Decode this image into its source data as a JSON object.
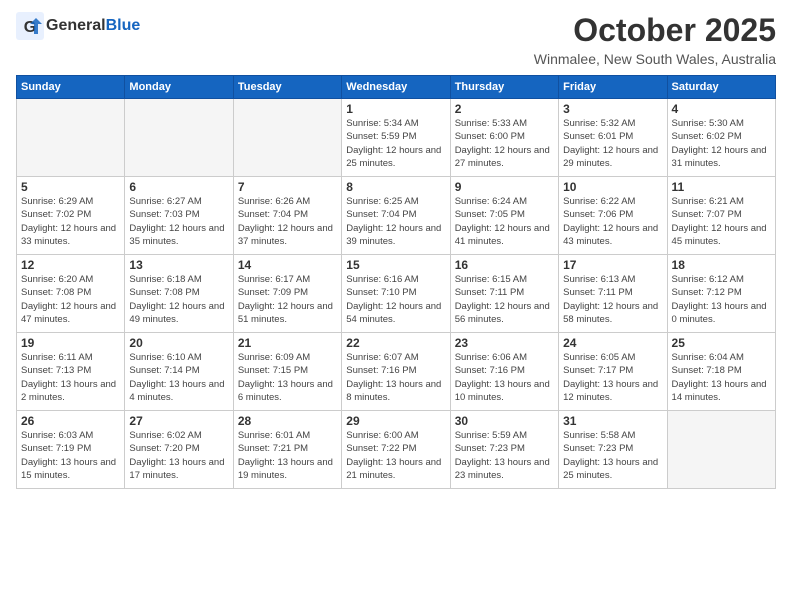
{
  "header": {
    "logo_general": "General",
    "logo_blue": "Blue",
    "month": "October 2025",
    "location": "Winmalee, New South Wales, Australia"
  },
  "days_of_week": [
    "Sunday",
    "Monday",
    "Tuesday",
    "Wednesday",
    "Thursday",
    "Friday",
    "Saturday"
  ],
  "weeks": [
    [
      {
        "date": "",
        "info": ""
      },
      {
        "date": "",
        "info": ""
      },
      {
        "date": "",
        "info": ""
      },
      {
        "date": "1",
        "info": "Sunrise: 5:34 AM\nSunset: 5:59 PM\nDaylight: 12 hours\nand 25 minutes."
      },
      {
        "date": "2",
        "info": "Sunrise: 5:33 AM\nSunset: 6:00 PM\nDaylight: 12 hours\nand 27 minutes."
      },
      {
        "date": "3",
        "info": "Sunrise: 5:32 AM\nSunset: 6:01 PM\nDaylight: 12 hours\nand 29 minutes."
      },
      {
        "date": "4",
        "info": "Sunrise: 5:30 AM\nSunset: 6:02 PM\nDaylight: 12 hours\nand 31 minutes."
      }
    ],
    [
      {
        "date": "5",
        "info": "Sunrise: 6:29 AM\nSunset: 7:02 PM\nDaylight: 12 hours\nand 33 minutes."
      },
      {
        "date": "6",
        "info": "Sunrise: 6:27 AM\nSunset: 7:03 PM\nDaylight: 12 hours\nand 35 minutes."
      },
      {
        "date": "7",
        "info": "Sunrise: 6:26 AM\nSunset: 7:04 PM\nDaylight: 12 hours\nand 37 minutes."
      },
      {
        "date": "8",
        "info": "Sunrise: 6:25 AM\nSunset: 7:04 PM\nDaylight: 12 hours\nand 39 minutes."
      },
      {
        "date": "9",
        "info": "Sunrise: 6:24 AM\nSunset: 7:05 PM\nDaylight: 12 hours\nand 41 minutes."
      },
      {
        "date": "10",
        "info": "Sunrise: 6:22 AM\nSunset: 7:06 PM\nDaylight: 12 hours\nand 43 minutes."
      },
      {
        "date": "11",
        "info": "Sunrise: 6:21 AM\nSunset: 7:07 PM\nDaylight: 12 hours\nand 45 minutes."
      }
    ],
    [
      {
        "date": "12",
        "info": "Sunrise: 6:20 AM\nSunset: 7:08 PM\nDaylight: 12 hours\nand 47 minutes."
      },
      {
        "date": "13",
        "info": "Sunrise: 6:18 AM\nSunset: 7:08 PM\nDaylight: 12 hours\nand 49 minutes."
      },
      {
        "date": "14",
        "info": "Sunrise: 6:17 AM\nSunset: 7:09 PM\nDaylight: 12 hours\nand 51 minutes."
      },
      {
        "date": "15",
        "info": "Sunrise: 6:16 AM\nSunset: 7:10 PM\nDaylight: 12 hours\nand 54 minutes."
      },
      {
        "date": "16",
        "info": "Sunrise: 6:15 AM\nSunset: 7:11 PM\nDaylight: 12 hours\nand 56 minutes."
      },
      {
        "date": "17",
        "info": "Sunrise: 6:13 AM\nSunset: 7:11 PM\nDaylight: 12 hours\nand 58 minutes."
      },
      {
        "date": "18",
        "info": "Sunrise: 6:12 AM\nSunset: 7:12 PM\nDaylight: 13 hours\nand 0 minutes."
      }
    ],
    [
      {
        "date": "19",
        "info": "Sunrise: 6:11 AM\nSunset: 7:13 PM\nDaylight: 13 hours\nand 2 minutes."
      },
      {
        "date": "20",
        "info": "Sunrise: 6:10 AM\nSunset: 7:14 PM\nDaylight: 13 hours\nand 4 minutes."
      },
      {
        "date": "21",
        "info": "Sunrise: 6:09 AM\nSunset: 7:15 PM\nDaylight: 13 hours\nand 6 minutes."
      },
      {
        "date": "22",
        "info": "Sunrise: 6:07 AM\nSunset: 7:16 PM\nDaylight: 13 hours\nand 8 minutes."
      },
      {
        "date": "23",
        "info": "Sunrise: 6:06 AM\nSunset: 7:16 PM\nDaylight: 13 hours\nand 10 minutes."
      },
      {
        "date": "24",
        "info": "Sunrise: 6:05 AM\nSunset: 7:17 PM\nDaylight: 13 hours\nand 12 minutes."
      },
      {
        "date": "25",
        "info": "Sunrise: 6:04 AM\nSunset: 7:18 PM\nDaylight: 13 hours\nand 14 minutes."
      }
    ],
    [
      {
        "date": "26",
        "info": "Sunrise: 6:03 AM\nSunset: 7:19 PM\nDaylight: 13 hours\nand 15 minutes."
      },
      {
        "date": "27",
        "info": "Sunrise: 6:02 AM\nSunset: 7:20 PM\nDaylight: 13 hours\nand 17 minutes."
      },
      {
        "date": "28",
        "info": "Sunrise: 6:01 AM\nSunset: 7:21 PM\nDaylight: 13 hours\nand 19 minutes."
      },
      {
        "date": "29",
        "info": "Sunrise: 6:00 AM\nSunset: 7:22 PM\nDaylight: 13 hours\nand 21 minutes."
      },
      {
        "date": "30",
        "info": "Sunrise: 5:59 AM\nSunset: 7:23 PM\nDaylight: 13 hours\nand 23 minutes."
      },
      {
        "date": "31",
        "info": "Sunrise: 5:58 AM\nSunset: 7:23 PM\nDaylight: 13 hours\nand 25 minutes."
      },
      {
        "date": "",
        "info": ""
      }
    ]
  ]
}
